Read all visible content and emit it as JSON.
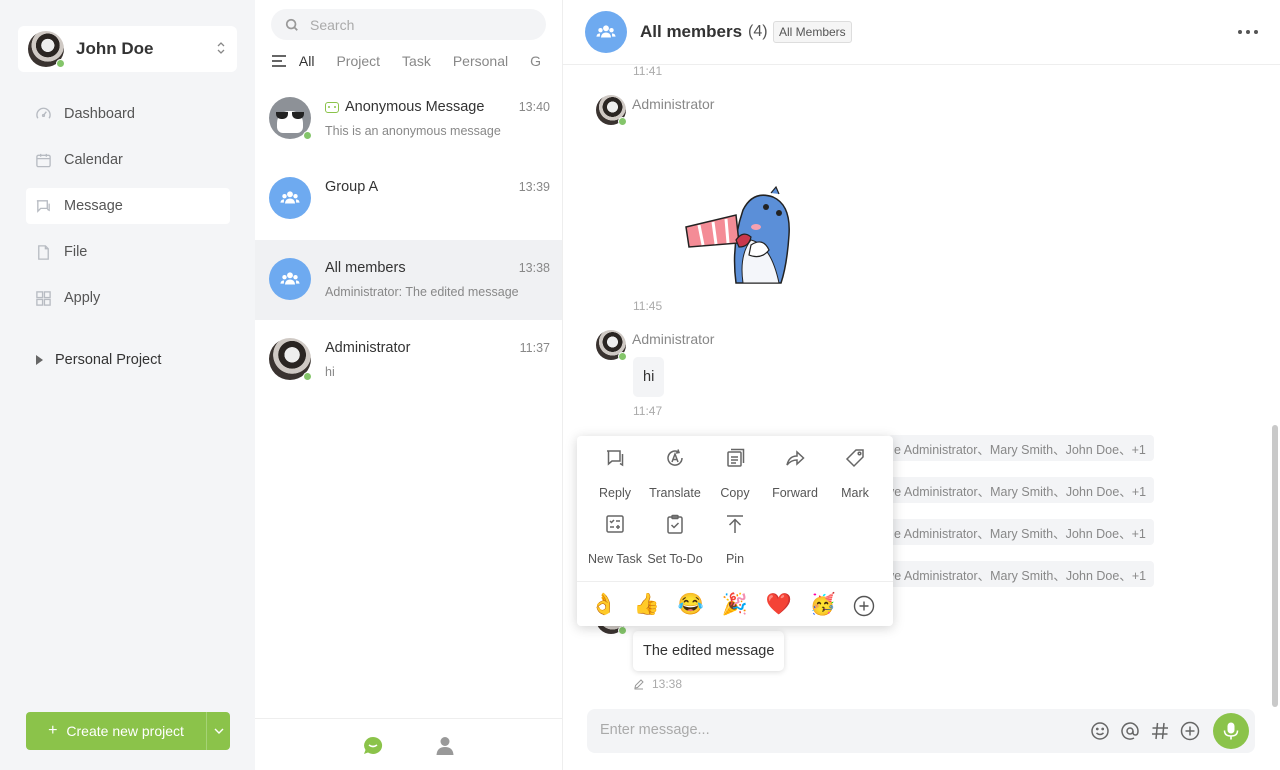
{
  "user": {
    "name": "John Doe"
  },
  "nav": {
    "items": [
      {
        "label": "Dashboard",
        "icon": "dashboard-icon"
      },
      {
        "label": "Calendar",
        "icon": "calendar-icon"
      },
      {
        "label": "Message",
        "icon": "message-icon",
        "active": true
      },
      {
        "label": "File",
        "icon": "file-icon"
      },
      {
        "label": "Apply",
        "icon": "apply-icon"
      }
    ],
    "project_toggle": "Personal Project",
    "create_button": "Create new project"
  },
  "conversations": {
    "search_placeholder": "Search",
    "filters": [
      "All",
      "Project",
      "Task",
      "Personal",
      "G"
    ],
    "active_filter": "All",
    "items": [
      {
        "name": "Anonymous Message",
        "time": "13:40",
        "preview": "This is an anonymous message",
        "avatar": "anonymous"
      },
      {
        "name": "Group A",
        "time": "13:39",
        "preview": "",
        "avatar": "group"
      },
      {
        "name": "All members",
        "time": "13:38",
        "preview": "Administrator: The edited message",
        "avatar": "group",
        "active": true
      },
      {
        "name": "Administrator",
        "time": "11:37",
        "preview": "hi",
        "avatar": "user"
      }
    ]
  },
  "chat": {
    "title": "All members",
    "count": "(4)",
    "tag": "All Members",
    "messages": {
      "top_time": "11:41",
      "sticker_author": "Administrator",
      "sticker_time": "11:45",
      "hi_author": "Administrator",
      "hi_text": "hi",
      "hi_time": "11:47",
      "edited_text": "The edited message",
      "edited_time": "13:38"
    },
    "readers": [
      "e Administrator、Mary Smith、John Doe、+1",
      "ve Administrator、Mary Smith、John Doe、+1",
      "e Administrator、Mary Smith、John Doe、+1",
      "ve Administrator、Mary Smith、John Doe、+1"
    ],
    "composer_placeholder": "Enter message..."
  },
  "context_menu": {
    "actions": [
      "Reply",
      "Translate",
      "Copy",
      "Forward",
      "Mark",
      "New Task",
      "Set To-Do",
      "Pin"
    ],
    "emojis": [
      "👌",
      "👍",
      "😂",
      "🎉",
      "❤️",
      "🥳"
    ]
  },
  "colors": {
    "accent": "#8bc34a",
    "group_avatar": "#6eaaf0",
    "online": "#84c56a"
  }
}
